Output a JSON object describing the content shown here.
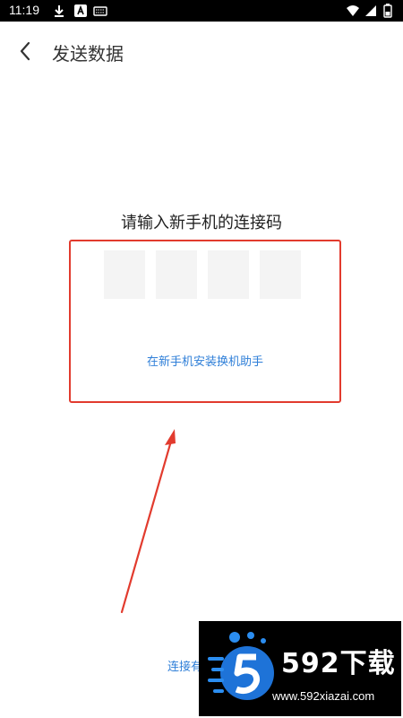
{
  "status_bar": {
    "time": "11:19",
    "icons": [
      "download-icon",
      "a-badge-icon",
      "keyboard-icon",
      "wifi-icon",
      "signal-icon",
      "battery-icon"
    ]
  },
  "header": {
    "back_icon": "chevron-left-icon",
    "title": "发送数据"
  },
  "main": {
    "prompt": "请输入新手机的连接码",
    "code_slots": [
      "",
      "",
      "",
      ""
    ],
    "install_link": "在新手机安装换机助手",
    "bottom_link_partial": "连接有"
  },
  "annotation": {
    "box_color": "#e23b2e",
    "arrow_color": "#e23b2e"
  },
  "watermark": {
    "brand": "592下载",
    "url": "www.592xiazai.com"
  },
  "colors": {
    "link": "#2f7fd8",
    "code_slot_bg": "#f4f4f4"
  }
}
